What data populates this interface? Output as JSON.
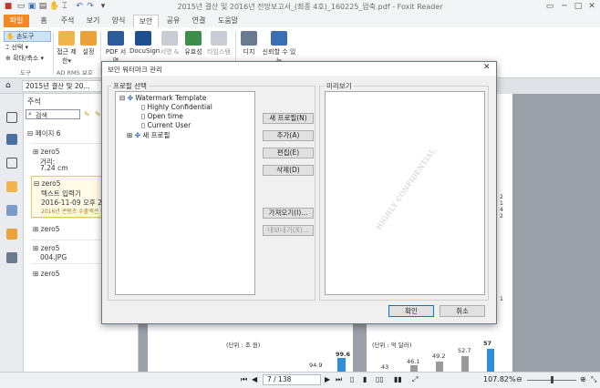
{
  "window": {
    "title": "2015년 결산 및 2016년 전망보고서_(최종 4호)_160225_압축.pdf - Foxit Reader",
    "controls": [
      "min",
      "max",
      "close"
    ]
  },
  "tabs": [
    "파일",
    "홈",
    "주석",
    "보기",
    "양식",
    "보안",
    "공유",
    "연결",
    "도움말"
  ],
  "search": {
    "value": "찾기"
  },
  "ribbon": {
    "tools": {
      "hand": "손도구",
      "select": "선택 ▾",
      "zoom": "확대/축소 ▾",
      "group": "도구"
    },
    "rms": {
      "permissions": "접근 제한▾",
      "settings": "설정",
      "group": "AD RMS 보호"
    },
    "buttons": [
      "PDF 서명",
      "DocuSign",
      "서명 &",
      "유효성",
      "타임스탬",
      "디지",
      "신뢰할 수 있는"
    ]
  },
  "docTab": {
    "title": "2015년 결산 및 20..."
  },
  "comments": {
    "header": "주석",
    "search_placeholder": "검색",
    "page": "페이지 6",
    "items": [
      {
        "author": "zero5",
        "text": "거리:",
        "value": "7.24 cm"
      },
      {
        "author": "zero5",
        "text": "텍스트 입력기",
        "date": "2016-11-09 오후 2:28",
        "note": "2016년 콘텐츠 수출액은 전년..."
      },
      {
        "author": "zero5"
      },
      {
        "author": "zero5",
        "text": "004.JPG"
      },
      {
        "author": "zero5"
      }
    ]
  },
  "dialog": {
    "title": "보안 워터마크 관리",
    "profileLabel": "프로필 선택",
    "previewLabel": "미리보기",
    "tree": {
      "root": "Watermark Template",
      "children": [
        "Highly Confidential",
        "Open time",
        "Current User"
      ],
      "newProfile": "새 프로필"
    },
    "buttons": {
      "newProfile": "새 프로필(N)",
      "add": "추가(A)",
      "edit": "편집(E)",
      "delete": "삭제(D)",
      "import": "가져오기(I)...",
      "export": "내보내기(X)...",
      "ok": "확인",
      "cancel": "취소"
    },
    "watermark": "HIGHLY CONFIDENTIAL"
  },
  "document": {
    "unit1": "(단위 : 조 원)",
    "unit2": "(단위 : 억 달러)",
    "chart1": {
      "values": [
        94.9,
        99.6
      ]
    },
    "chart2": {
      "values": [
        43.0,
        46.1,
        49.2,
        52.7,
        57.0
      ]
    }
  },
  "status": {
    "page": "7 / 138",
    "zoom": "107.82%"
  },
  "colors": {
    "file_tab": "#f08a24",
    "accent": "#2f8fd8",
    "primary_border": "#0078d7"
  }
}
